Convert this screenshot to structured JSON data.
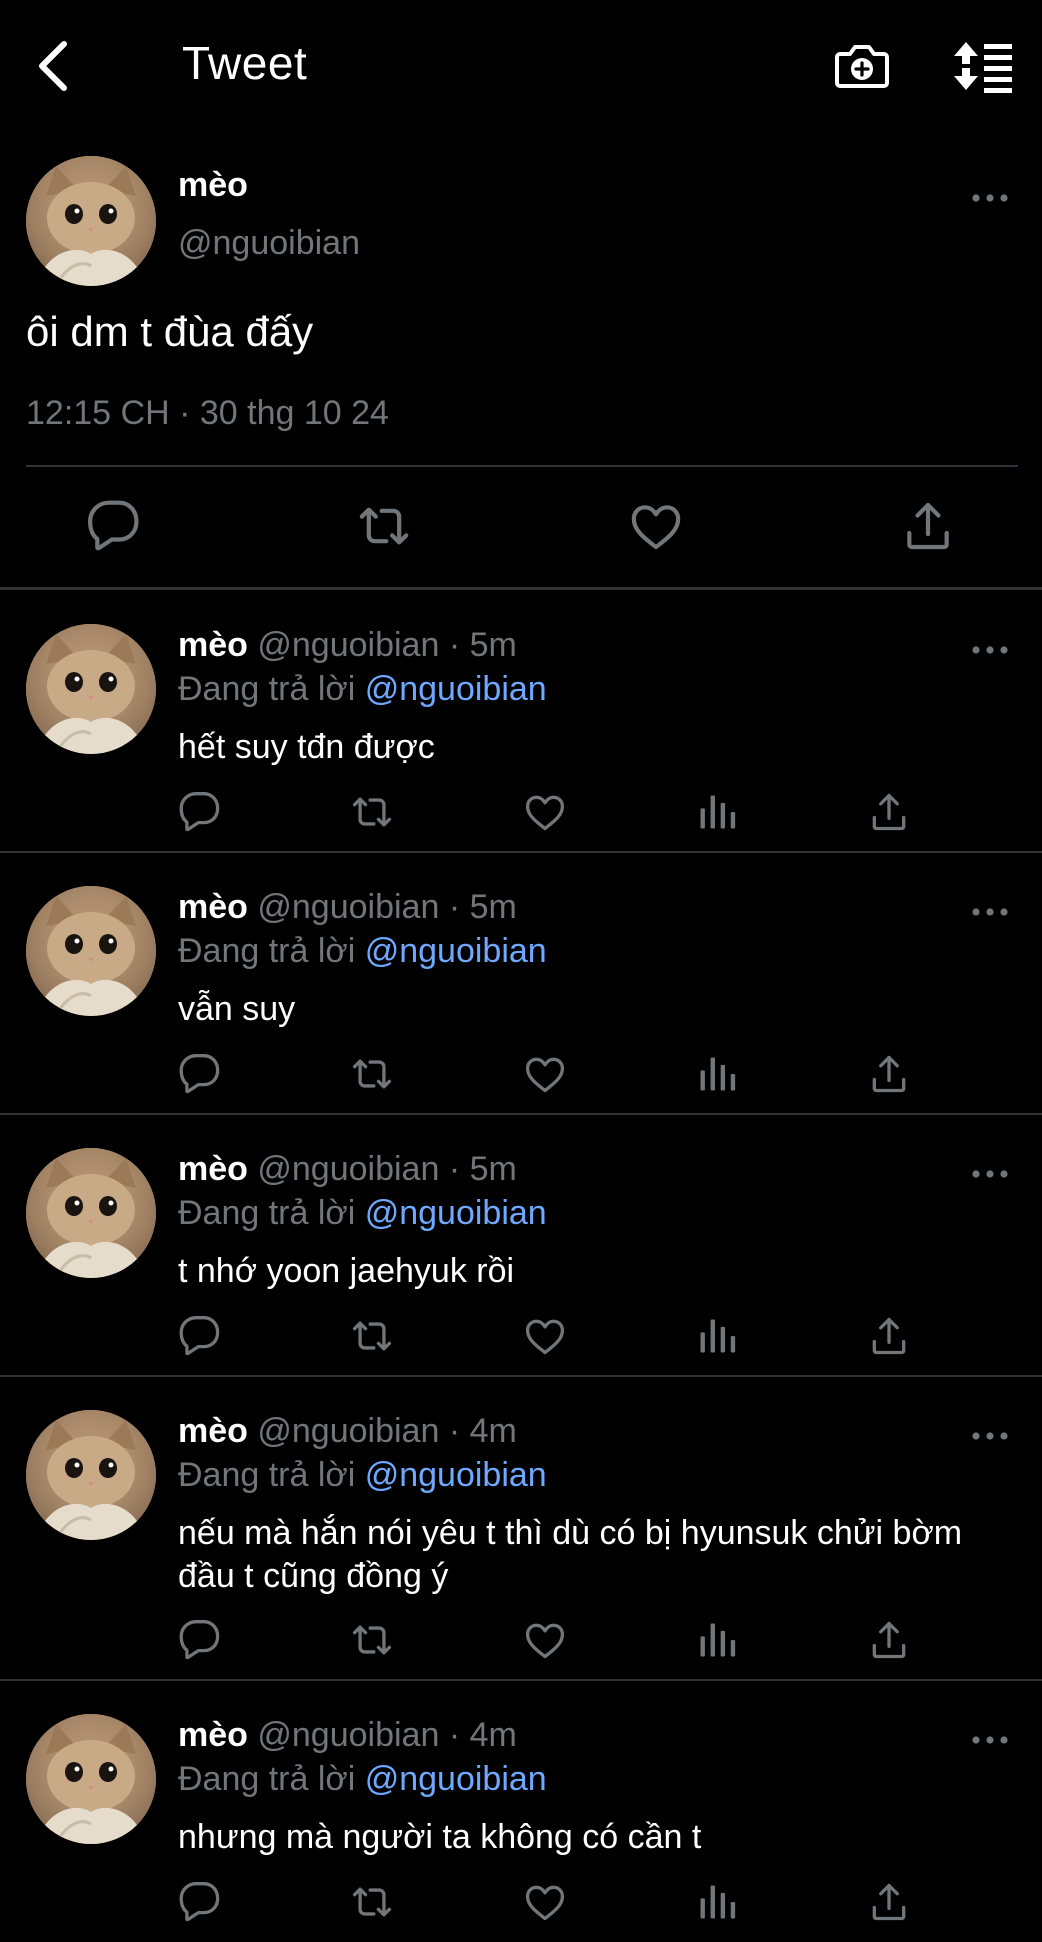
{
  "header": {
    "title": "Tweet"
  },
  "main_tweet": {
    "name": "mèo",
    "handle": "@nguoibian",
    "text": "ôi dm t đùa đấy",
    "timestamp": "12:15 CH · 30 thg 10 24"
  },
  "replies": [
    {
      "name": "mèo",
      "handle": "@nguoibian",
      "dot": "·",
      "time": "5m",
      "reply_label": "Đang trả lời",
      "mention": "@nguoibian",
      "text": "hết suy tđn được"
    },
    {
      "name": "mèo",
      "handle": "@nguoibian",
      "dot": "·",
      "time": "5m",
      "reply_label": "Đang trả lời",
      "mention": "@nguoibian",
      "text": "vẫn suy"
    },
    {
      "name": "mèo",
      "handle": "@nguoibian",
      "dot": "·",
      "time": "5m",
      "reply_label": "Đang trả lời",
      "mention": "@nguoibian",
      "text": "t nhớ yoon jaehyuk rồi"
    },
    {
      "name": "mèo",
      "handle": "@nguoibian",
      "dot": "·",
      "time": "4m",
      "reply_label": "Đang trả lời",
      "mention": "@nguoibian",
      "text": "nếu mà hắn nói yêu t thì dù có bị hyunsuk chửi bờm đầu t cũng đồng ý"
    },
    {
      "name": "mèo",
      "handle": "@nguoibian",
      "dot": "·",
      "time": "4m",
      "reply_label": "Đang trả lời",
      "mention": "@nguoibian",
      "text": "nhưng mà người ta không có cần t"
    }
  ],
  "colors": {
    "background": "#000000",
    "text": "#e7e9ea",
    "secondary": "#71767b",
    "mention": "#6fa9ff",
    "divider": "#2f3336"
  },
  "icons": [
    "back-arrow-icon",
    "camera-plus-icon",
    "sort-icon",
    "more-icon",
    "reply-icon",
    "retweet-icon",
    "like-icon",
    "views-icon",
    "share-icon"
  ]
}
